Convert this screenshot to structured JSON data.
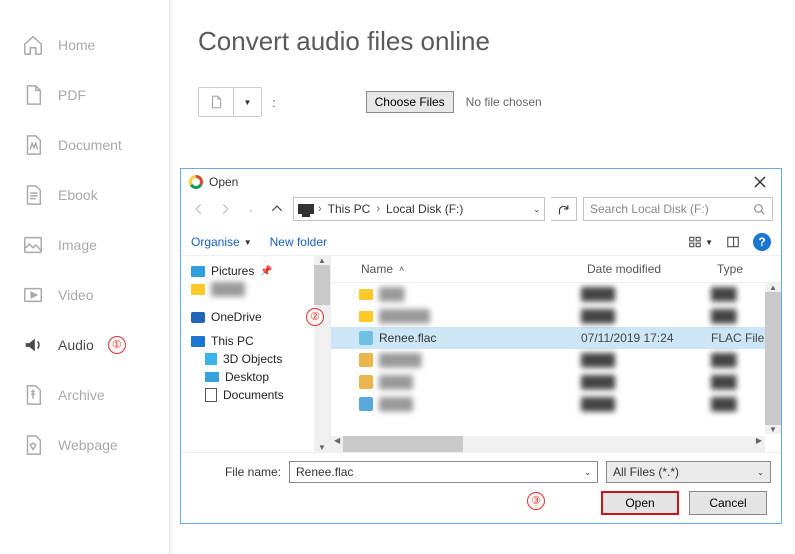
{
  "sidebar": {
    "items": [
      {
        "label": "Home",
        "icon": "home"
      },
      {
        "label": "PDF",
        "icon": "pdf"
      },
      {
        "label": "Document",
        "icon": "document"
      },
      {
        "label": "Ebook",
        "icon": "ebook"
      },
      {
        "label": "Image",
        "icon": "image"
      },
      {
        "label": "Video",
        "icon": "video"
      },
      {
        "label": "Audio",
        "icon": "audio"
      },
      {
        "label": "Archive",
        "icon": "archive"
      },
      {
        "label": "Webpage",
        "icon": "webpage"
      }
    ]
  },
  "page": {
    "title": "Convert audio files online",
    "choose_files_label": "Choose Files",
    "no_file_chosen": "No file chosen"
  },
  "markers": {
    "one": "①",
    "two": "②",
    "three": "③"
  },
  "dialog": {
    "title": "Open",
    "breadcrumb": [
      "This PC",
      "Local Disk (F:)"
    ],
    "search_placeholder": "Search Local Disk (F:)",
    "organise_label": "Organise",
    "new_folder_label": "New folder",
    "columns": {
      "name": "Name",
      "date": "Date modified",
      "type": "Type"
    },
    "tree": [
      {
        "label": "Pictures",
        "pinned": true,
        "icon": "pictures"
      },
      {
        "label": "",
        "icon": "folder",
        "blurred": true
      },
      {
        "label": "OneDrive",
        "icon": "onedrive"
      },
      {
        "label": "This PC",
        "icon": "thispc"
      },
      {
        "label": "3D Objects",
        "icon": "cube",
        "sub": true
      },
      {
        "label": "Desktop",
        "icon": "desktop",
        "sub": true
      },
      {
        "label": "Documents",
        "icon": "documents",
        "sub": true,
        "truncated": true
      }
    ],
    "files": [
      {
        "name": "",
        "date": "",
        "type": "",
        "blurred": true
      },
      {
        "name": "",
        "date": "",
        "type": "",
        "blurred": true
      },
      {
        "name": "Renee.flac",
        "date": "07/11/2019 17:24",
        "type": "FLAC File",
        "selected": true
      },
      {
        "name": "",
        "date": "",
        "type": "",
        "blurred": true
      },
      {
        "name": "",
        "date": "",
        "type": "",
        "blurred": true
      },
      {
        "name": "",
        "date": "",
        "type": "",
        "blurred": true
      }
    ],
    "file_name_label": "File name:",
    "file_name_value": "Renee.flac",
    "filter_value": "All Files (*.*)",
    "open_label": "Open",
    "cancel_label": "Cancel"
  }
}
